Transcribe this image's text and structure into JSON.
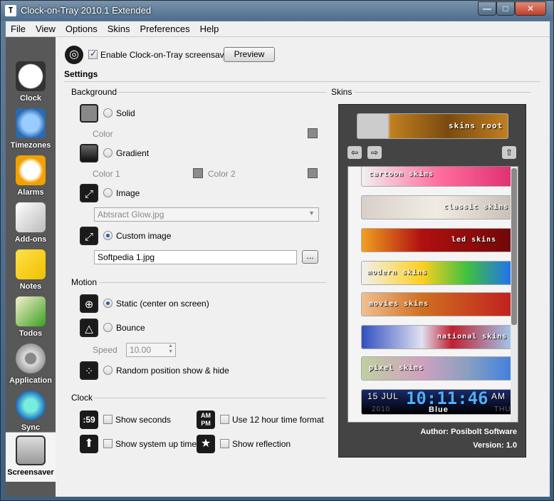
{
  "window": {
    "app_icon": "T",
    "title": "Clock-on-Tray 2010.1 Extended",
    "minimize": "—",
    "maximize": "□",
    "close": "✕"
  },
  "menu": [
    "File",
    "View",
    "Options",
    "Skins",
    "Preferences",
    "Help"
  ],
  "sidebar": [
    {
      "label": "Clock",
      "icon": "clock-icon"
    },
    {
      "label": "Timezones",
      "icon": "globe-clock-icon"
    },
    {
      "label": "Alarms",
      "icon": "alarm-clock-icon"
    },
    {
      "label": "Add-ons",
      "icon": "dice-icon"
    },
    {
      "label": "Notes",
      "icon": "sticky-note-icon"
    },
    {
      "label": "Todos",
      "icon": "checklist-icon"
    },
    {
      "label": "Application",
      "icon": "gear-icon"
    },
    {
      "label": "Sync",
      "icon": "globe-icon"
    },
    {
      "label": "Screensaver",
      "icon": "monitor-icon"
    }
  ],
  "top": {
    "enable_label": "Enable Clock-on-Tray screensaver",
    "enable_checked": true,
    "preview_label": "Preview"
  },
  "settings_header": "Settings",
  "background": {
    "header": "Background",
    "solid_label": "Solid",
    "color_label": "Color",
    "gradient_label": "Gradient",
    "color1_label": "Color 1",
    "color2_label": "Color 2",
    "image_label": "Image",
    "image_value": "Abtsract Glow.jpg",
    "custom_label": "Custom image",
    "custom_value": "Softpedia 1.jpg",
    "browse_label": "...",
    "selected": "custom"
  },
  "motion": {
    "header": "Motion",
    "static_label": "Static (center on screen)",
    "bounce_label": "Bounce",
    "speed_label": "Speed",
    "speed_value": "10.00",
    "random_label": "Random position show & hide",
    "selected": "static"
  },
  "clock": {
    "header": "Clock",
    "seconds_icon": ":59",
    "show_seconds": "Show seconds",
    "ampm_icon": "AM PM",
    "twelve_hour": "Use 12 hour time format",
    "uptime": "Show system up time",
    "reflection": "Show reflection"
  },
  "skins": {
    "header": "Skins",
    "root_label": "skins root",
    "items": [
      {
        "label": "cartoon skins",
        "color": "#c04060"
      },
      {
        "label": "classic skins",
        "color": "#b0a898"
      },
      {
        "label": "led skins",
        "color": "#9a1010"
      },
      {
        "label": "modern skins",
        "color": "#30a040"
      },
      {
        "label": "movies skins",
        "color": "#c07030"
      },
      {
        "label": "national skins",
        "color": "#3060b0"
      },
      {
        "label": "pixel skins",
        "color": "#7a8aa0"
      }
    ],
    "preview": {
      "date": "15 JUL",
      "time": "10:11:46",
      "ampm": "AM",
      "year": "2010",
      "day": "THU",
      "name": "Blue"
    },
    "author": "Author: Posibolt Software",
    "version": "Version: 1.0"
  },
  "colors": {
    "accent": "#1f5fb7",
    "panel": "#444444"
  }
}
